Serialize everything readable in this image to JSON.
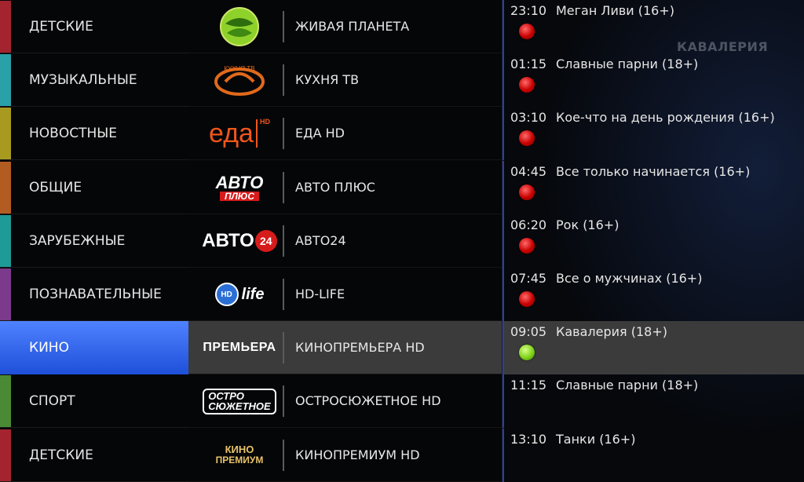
{
  "background": {
    "program_title": "КАВАЛЕРИЯ"
  },
  "categories": [
    {
      "label": "ДЕТСКИЕ",
      "color": "#a3242f"
    },
    {
      "label": "МУЗЫКАЛЬНЫЕ",
      "color": "#2aa0a8"
    },
    {
      "label": "НОВОСТНЫЕ",
      "color": "#a89a1f"
    },
    {
      "label": "ОБЩИЕ",
      "color": "#b25c22"
    },
    {
      "label": "ЗАРУБЕЖНЫЕ",
      "color": "#1e9a97"
    },
    {
      "label": "ПОЗНАВАТЕЛЬНЫЕ",
      "color": "#7b3a8c"
    },
    {
      "label": "КИНО",
      "color": "#3d6ef0",
      "selected": true
    },
    {
      "label": "СПОРТ",
      "color": "#4b8a34"
    },
    {
      "label": "ДЕТСКИЕ",
      "color": "#a3242f"
    }
  ],
  "channels": [
    {
      "name": "ЖИВАЯ ПЛАНЕТА",
      "logo": "zhivaya-planeta-logo"
    },
    {
      "name": "КУХНЯ ТВ",
      "logo": "kuhnya-tv-logo",
      "logo_text": "КУХНЯ ТВ"
    },
    {
      "name": "ЕДА HD",
      "logo": "eda-hd-logo",
      "logo_text": "еда",
      "logo_sub": "HD"
    },
    {
      "name": "АВТО ПЛЮС",
      "logo": "avto-plus-logo",
      "logo_text": "АВТО",
      "logo_sub": "ПЛЮС"
    },
    {
      "name": "АВТО24",
      "logo": "avto24-logo",
      "logo_text": "АВТО",
      "logo_sub": "24"
    },
    {
      "name": "HD-LIFE",
      "logo": "hd-life-logo",
      "logo_text": "life",
      "logo_sub": "HD"
    },
    {
      "name": "КИНОПРЕМЬЕРА HD",
      "logo": "premiera-logo",
      "logo_text": "ПРЕМЬЕРА",
      "selected": true
    },
    {
      "name": "ОСТРОСЮЖЕТНОЕ HD",
      "logo": "ostrosyuzhetnoe-logo",
      "logo_text": "ОСТРО",
      "logo_sub": "СЮЖЕТНОЕ"
    },
    {
      "name": "КИНОПРЕМИУМ HD",
      "logo": "kinopremium-logo",
      "logo_text": "КИНО",
      "logo_sub": "ПРЕМИУМ"
    }
  ],
  "episodes": [
    {
      "time": "23:10",
      "title": "Меган Ливи (16+)",
      "status": "rec"
    },
    {
      "time": "01:15",
      "title": "Славные парни (18+)",
      "status": "rec"
    },
    {
      "time": "03:10",
      "title": "Кое-что на день рождения (16+)",
      "status": "rec"
    },
    {
      "time": "04:45",
      "title": "Все только начинается (16+)",
      "status": "rec"
    },
    {
      "time": "06:20",
      "title": "Рок (16+)",
      "status": "rec"
    },
    {
      "time": "07:45",
      "title": "Все о мужчинах (16+)",
      "status": "rec"
    },
    {
      "time": "09:05",
      "title": "Кавалерия (18+)",
      "status": "live",
      "selected": true
    },
    {
      "time": "11:15",
      "title": "Славные парни (18+)",
      "status": ""
    },
    {
      "time": "13:10",
      "title": "Танки (16+)",
      "status": ""
    }
  ],
  "icons": {
    "rec": "red-record-dot-icon",
    "live": "green-live-dot-icon"
  }
}
